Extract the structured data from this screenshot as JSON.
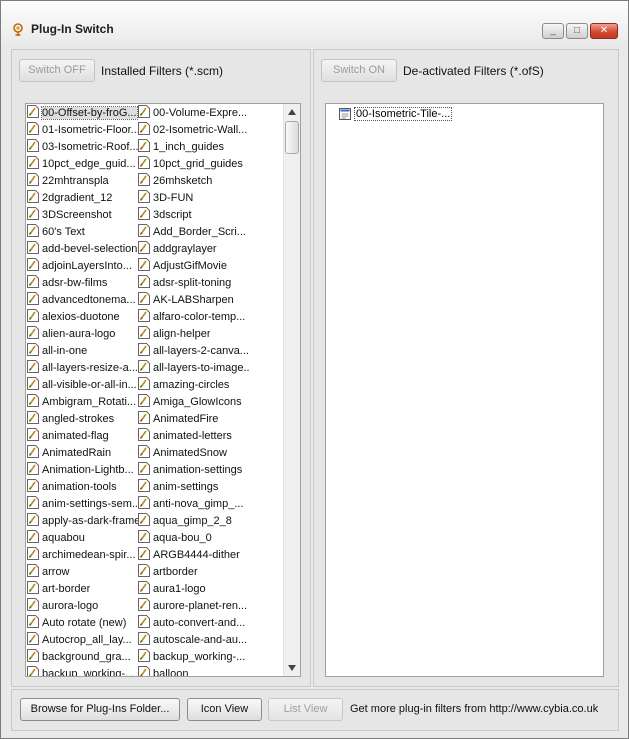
{
  "window": {
    "title": "Plug-In Switch",
    "controls": {
      "minimize": "_",
      "maximize": "□",
      "close": "✕"
    }
  },
  "left_panel": {
    "switch_button": "Switch OFF",
    "header": "Installed Filters (*.scm)"
  },
  "right_panel": {
    "switch_button": "Switch ON",
    "header": "De-activated Filters (*.ofS)",
    "items": [
      "00-Isometric-Tile-..."
    ]
  },
  "installed_filters": [
    [
      "00-Offset-by-froG...",
      "00-Volume-Expre..."
    ],
    [
      "01-Isometric-Floor...",
      "02-Isometric-Wall..."
    ],
    [
      "03-Isometric-Roof...",
      "1_inch_guides"
    ],
    [
      "10pct_edge_guid...",
      "10pct_grid_guides"
    ],
    [
      "22mhtranspla",
      "26mhsketch"
    ],
    [
      "2dgradient_12",
      "3D-FUN"
    ],
    [
      "3DScreenshot",
      "3dscript"
    ],
    [
      "60's Text",
      "Add_Border_Scri..."
    ],
    [
      "add-bevel-selection",
      "addgraylayer"
    ],
    [
      "adjoinLayersInto...",
      "AdjustGifMovie"
    ],
    [
      "adsr-bw-films",
      "adsr-split-toning"
    ],
    [
      "advancedtonema...",
      "AK-LABSharpen"
    ],
    [
      "alexios-duotone",
      "alfaro-color-temp..."
    ],
    [
      "alien-aura-logo",
      "align-helper"
    ],
    [
      "all-in-one",
      "all-layers-2-canva..."
    ],
    [
      "all-layers-resize-a...",
      "all-layers-to-image..."
    ],
    [
      "all-visible-or-all-in...",
      "amazing-circles"
    ],
    [
      "Ambigram_Rotati...",
      "Amiga_GlowIcons"
    ],
    [
      "angled-strokes",
      "AnimatedFire"
    ],
    [
      "animated-flag",
      "animated-letters"
    ],
    [
      "AnimatedRain",
      "AnimatedSnow"
    ],
    [
      "Animation-Lightb...",
      "animation-settings"
    ],
    [
      "animation-tools",
      "anim-settings"
    ],
    [
      "anim-settings-sem...",
      "anti-nova_gimp_..."
    ],
    [
      "apply-as-dark-frame",
      "aqua_gimp_2_8"
    ],
    [
      "aquabou",
      "aqua-bou_0"
    ],
    [
      "archimedean-spir...",
      "ARGB4444-dither"
    ],
    [
      "arrow",
      "artborder"
    ],
    [
      "art-border",
      "aura1-logo"
    ],
    [
      "aurora-logo",
      "aurore-planet-ren..."
    ],
    [
      "Auto rotate (new)",
      "auto-convert-and..."
    ],
    [
      "Autocrop_all_lay...",
      "autoscale-and-au..."
    ],
    [
      "background_gra...",
      "backup_working-..."
    ],
    [
      "backup_working-...",
      "balloon"
    ]
  ],
  "bottom": {
    "browse_button": "Browse for Plug-Ins Folder...",
    "icon_view_button": "Icon View",
    "list_view_button": "List View",
    "more_text": "Get more plug-in filters from http://www.cybia.co.uk"
  },
  "colors": {
    "window_bg": "#e9e9e9",
    "close_red": "#d24a34",
    "selection": "#dedede"
  }
}
